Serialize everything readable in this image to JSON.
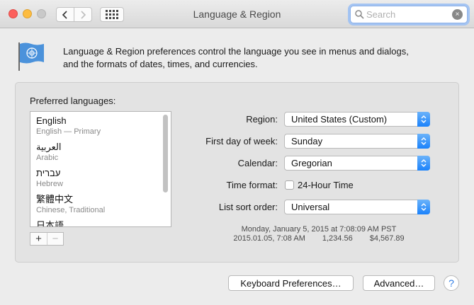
{
  "window": {
    "title": "Language & Region"
  },
  "search": {
    "placeholder": "Search",
    "clear_glyph": "×"
  },
  "toolbar": {
    "back_icon": "chevron-left-icon",
    "forward_icon": "chevron-right-icon",
    "grid_icon": "show-all-grid-icon"
  },
  "description": {
    "line1": "Language & Region preferences control the language you see in menus and dialogs,",
    "line2": "and the formats of dates, times, and currencies."
  },
  "languages": {
    "label": "Preferred languages:",
    "items": [
      {
        "name": "English",
        "sub": "English — Primary"
      },
      {
        "name": "العربية",
        "sub": "Arabic"
      },
      {
        "name": "עברית",
        "sub": "Hebrew"
      },
      {
        "name": "繁體中文",
        "sub": "Chinese, Traditional"
      },
      {
        "name": "日本語",
        "sub": ""
      }
    ],
    "add_label": "+",
    "remove_label": "−"
  },
  "settings": {
    "region": {
      "label": "Region:",
      "value": "United States (Custom)"
    },
    "first_day": {
      "label": "First day of week:",
      "value": "Sunday"
    },
    "calendar": {
      "label": "Calendar:",
      "value": "Gregorian"
    },
    "time_format": {
      "label": "Time format:",
      "checkbox_label": "24-Hour Time",
      "checked": false
    },
    "sort_order": {
      "label": "List sort order:",
      "value": "Universal"
    }
  },
  "sample": {
    "line1": "Monday, January 5, 2015 at 7:08:09 AM PST",
    "date_short": "2015.01.05, 7:08 AM",
    "number": "1,234.56",
    "currency": "$4,567.89"
  },
  "buttons": {
    "keyboard": "Keyboard Preferences…",
    "advanced": "Advanced…",
    "help": "?"
  },
  "colors": {
    "accent": "#1a82fb",
    "close": "#fc605c",
    "minimize": "#fdbc40",
    "zoom_disabled": "#c9c9c9"
  }
}
